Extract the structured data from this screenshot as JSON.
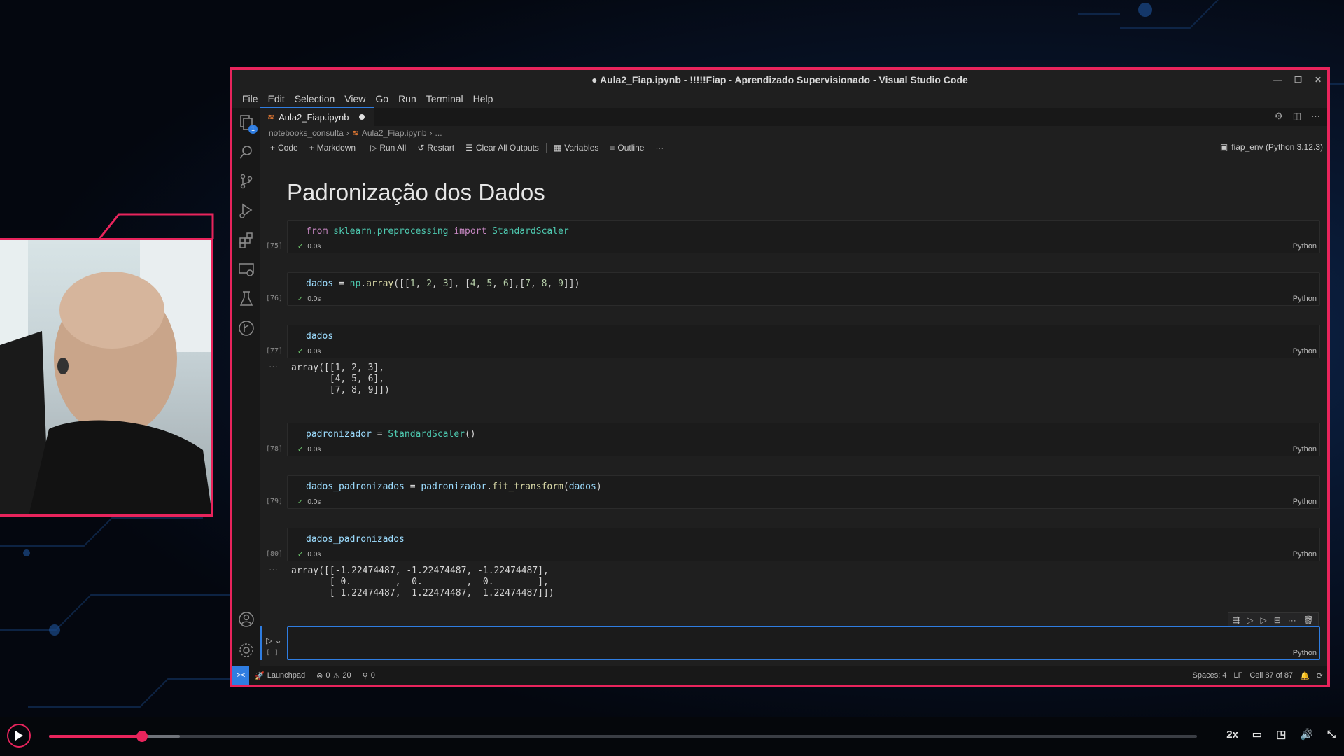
{
  "window": {
    "title": "● Aula2_Fiap.ipynb - !!!!!Fiap - Aprendizado Supervisionado - Visual Studio Code"
  },
  "menu": [
    "File",
    "Edit",
    "Selection",
    "View",
    "Go",
    "Run",
    "Terminal",
    "Help"
  ],
  "activity": {
    "explorer_badge": "1"
  },
  "tab": {
    "label": "Aula2_Fiap.ipynb"
  },
  "breadcrumb": {
    "folder": "notebooks_consulta",
    "file": "Aula2_Fiap.ipynb",
    "more": "..."
  },
  "toolbar": {
    "code": "Code",
    "markdown": "Markdown",
    "run_all": "Run All",
    "restart": "Restart",
    "clear_outputs": "Clear All Outputs",
    "variables": "Variables",
    "outline": "Outline",
    "more": "···",
    "kernel": "fiap_env (Python 3.12.3)"
  },
  "notebook": {
    "heading": "Padronização dos Dados",
    "cells": [
      {
        "count": "[75]",
        "time": "0.0s",
        "lang": "Python",
        "code": "from sklearn.preprocessing import StandardScaler"
      },
      {
        "count": "[76]",
        "time": "0.0s",
        "lang": "Python",
        "code": "dados = np.array([[1, 2, 3], [4, 5, 6],[7, 8, 9]])"
      },
      {
        "count": "[77]",
        "time": "0.0s",
        "lang": "Python",
        "code": "dados",
        "output": "array([[1, 2, 3],\n       [4, 5, 6],\n       [7, 8, 9]])"
      },
      {
        "count": "[78]",
        "time": "0.0s",
        "lang": "Python",
        "code": "padronizador = StandardScaler()"
      },
      {
        "count": "[79]",
        "time": "0.0s",
        "lang": "Python",
        "code": "dados_padronizados = padronizador.fit_transform(dados)"
      },
      {
        "count": "[80]",
        "time": "0.0s",
        "lang": "Python",
        "code": "dados_padronizados",
        "output": "array([[-1.22474487, -1.22474487, -1.22474487],\n       [ 0.        ,  0.        ,  0.        ],\n       [ 1.22474487,  1.22474487,  1.22474487]])"
      },
      {
        "count": "[ ]",
        "time": "",
        "lang": "Python",
        "code": ""
      }
    ],
    "output_dots": "···"
  },
  "statusbar": {
    "remote": "><",
    "launchpad": "Launchpad",
    "errors": "0",
    "warnings": "20",
    "ports": "0",
    "spaces": "Spaces: 4",
    "eol": "LF",
    "cell_pos": "Cell 87 of 87"
  },
  "player": {
    "progress_fraction": 0.081,
    "speed": "2x"
  },
  "colors": {
    "accent": "#e8245c",
    "vscode_blue": "#2f7de1"
  }
}
